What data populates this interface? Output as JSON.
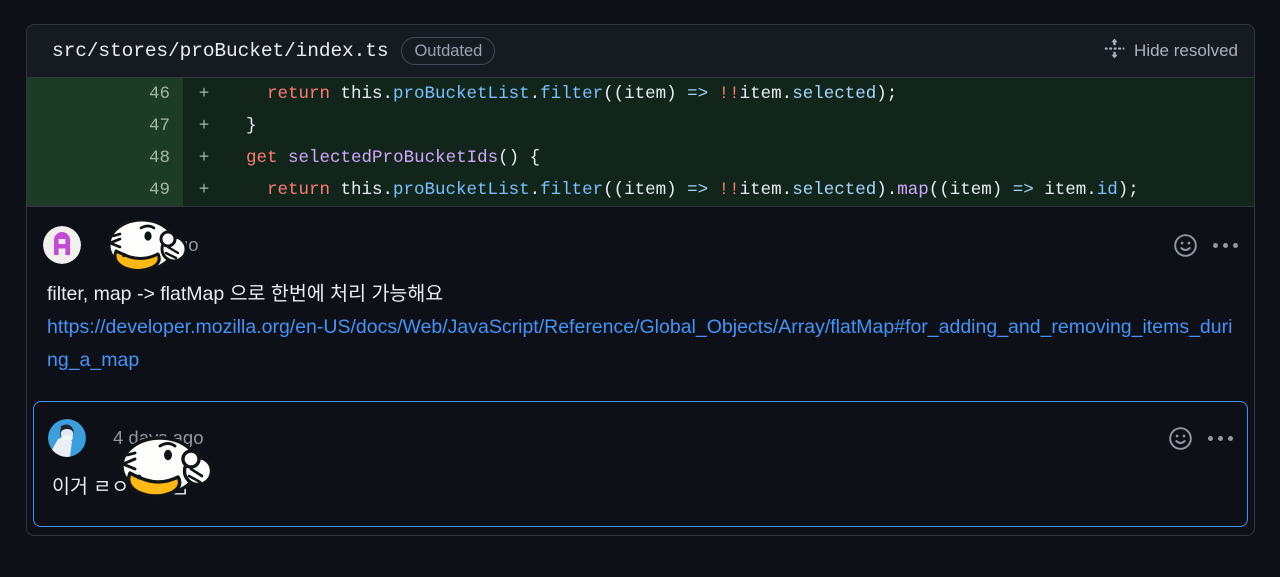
{
  "file_header": {
    "path": "src/stores/proBucket/index.ts",
    "badge": "Outdated",
    "hide_resolved_label": "Hide resolved",
    "fold_icon": "fold-icon"
  },
  "diff": {
    "language": "typescript",
    "lines": [
      {
        "number": "46",
        "marker": "+",
        "tokens": [
          {
            "text": "    ",
            "cls": "t-pun"
          },
          {
            "text": "return",
            "cls": "t-kw"
          },
          {
            "text": " this.",
            "cls": "t-pun"
          },
          {
            "text": "proBucketList",
            "cls": "t-prop"
          },
          {
            "text": ".",
            "cls": "t-pun"
          },
          {
            "text": "filter",
            "cls": "t-prop"
          },
          {
            "text": "((item) ",
            "cls": "t-pun"
          },
          {
            "text": "=>",
            "cls": "t-op"
          },
          {
            "text": " ",
            "cls": "t-pun"
          },
          {
            "text": "!!",
            "cls": "t-kw"
          },
          {
            "text": "item.",
            "cls": "t-pun"
          },
          {
            "text": "selected",
            "cls": "t-op"
          },
          {
            "text": ");",
            "cls": "t-pun"
          }
        ]
      },
      {
        "number": "47",
        "marker": "+",
        "tokens": [
          {
            "text": "  }",
            "cls": "t-pun"
          }
        ]
      },
      {
        "number": "48",
        "marker": "+",
        "tokens": [
          {
            "text": "  ",
            "cls": "t-pun"
          },
          {
            "text": "get",
            "cls": "t-kw"
          },
          {
            "text": " ",
            "cls": "t-pun"
          },
          {
            "text": "selectedProBucketIds",
            "cls": "t-ent"
          },
          {
            "text": "() {",
            "cls": "t-pun"
          }
        ]
      },
      {
        "number": "49",
        "marker": "+",
        "tokens": [
          {
            "text": "    ",
            "cls": "t-pun"
          },
          {
            "text": "return",
            "cls": "t-kw"
          },
          {
            "text": " this.",
            "cls": "t-pun"
          },
          {
            "text": "proBucketList",
            "cls": "t-prop"
          },
          {
            "text": ".",
            "cls": "t-pun"
          },
          {
            "text": "filter",
            "cls": "t-prop"
          },
          {
            "text": "((item) ",
            "cls": "t-pun"
          },
          {
            "text": "=>",
            "cls": "t-op"
          },
          {
            "text": " ",
            "cls": "t-pun"
          },
          {
            "text": "!!",
            "cls": "t-kw"
          },
          {
            "text": "item.",
            "cls": "t-pun"
          },
          {
            "text": "selected",
            "cls": "t-op"
          },
          {
            "text": ").",
            "cls": "t-pun"
          },
          {
            "text": "map",
            "cls": "t-fn"
          },
          {
            "text": "((item) ",
            "cls": "t-pun"
          },
          {
            "text": "=>",
            "cls": "t-op"
          },
          {
            "text": " item.",
            "cls": "t-pun"
          },
          {
            "text": "id",
            "cls": "t-prop"
          },
          {
            "text": ");",
            "cls": "t-pun"
          }
        ]
      }
    ]
  },
  "comments": [
    {
      "author": "",
      "timestamp": "4 days ago",
      "avatar_type": "letter-avatar-a",
      "avatar_letter": "A",
      "avatar_color": "#c24ad6",
      "focused": false,
      "text": "filter, map -> flatMap 으로 한번에 처리 가능해요",
      "link_text": "https://developer.mozilla.org/en-US/docs/Web/JavaScript/Reference/Global_Objects/Array/flatMap#for_adding_and_removing_items_during_a_map",
      "reaction_icon": "smiley-icon",
      "menu_icon": "kebab-menu-icon"
    },
    {
      "author": "",
      "timestamp": "4 days ago",
      "avatar_type": "photo-avatar",
      "focused": true,
      "text": "이거 ㄹㅇ 개꿀임",
      "link_text": "",
      "reaction_icon": "smiley-icon",
      "menu_icon": "kebab-menu-icon"
    }
  ],
  "colors": {
    "page_background": "#0d1117",
    "card_border": "#30363d",
    "header_background": "#161b22",
    "diff_added_background": "#12251a",
    "diff_gutter_background": "#1d3c26",
    "link": "#4493f8",
    "focus_border": "#4493f8",
    "muted_text": "#9198a1"
  },
  "stickers": [
    {
      "name": "duck-sticker-1",
      "covers": "comment-1-author"
    },
    {
      "name": "duck-sticker-2",
      "covers": "comment-2-author"
    }
  ]
}
